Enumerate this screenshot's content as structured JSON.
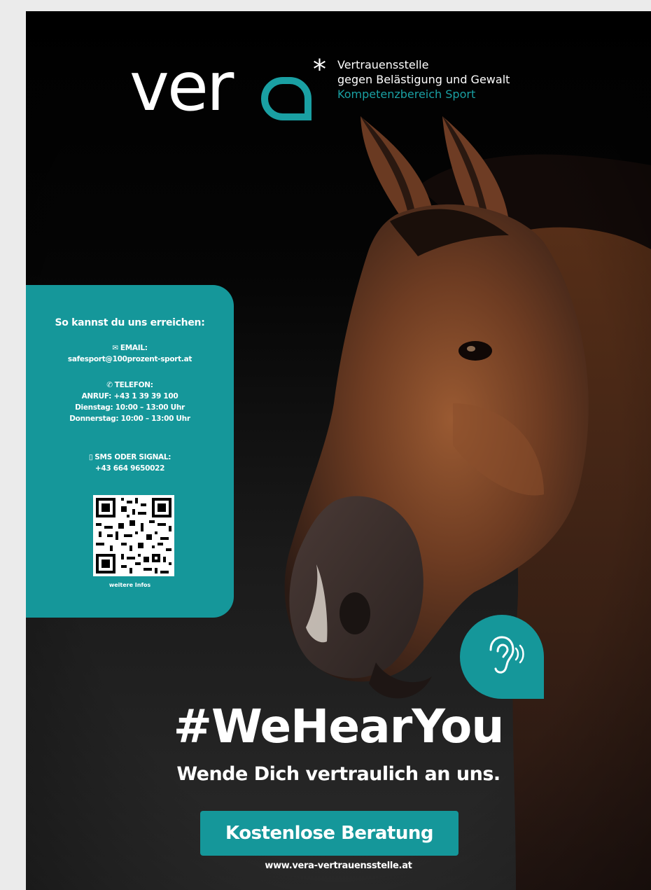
{
  "logo": {
    "word": "ver",
    "star": "*",
    "tagline_line1": "Vertrauensstelle",
    "tagline_line2": "gegen Belästigung und Gewalt",
    "tagline_line3": "Kompetenzbereich Sport",
    "accent_color": "#1aa0a3"
  },
  "contact": {
    "title": "So kannst du uns erreichen:",
    "email_icon": "envelope-icon",
    "email_label": "EMAIL:",
    "email_value": "safesport@100prozent-sport.at",
    "phone_icon": "phone-icon",
    "phone_label": "TELEFON:",
    "phone_call": "ANRUF: +43 1 39 39 100",
    "phone_hours1": "Dienstag: 10:00 – 13:00 Uhr",
    "phone_hours2": "Donnerstag: 10:00 – 13:00 Uhr",
    "sms_icon": "mobile-icon",
    "sms_label": "SMS ODER SIGNAL:",
    "sms_value": "+43 664 9650022",
    "qr_caption": "weitere Infos",
    "panel_color": "#15979a"
  },
  "ear_icon": "ear-listening-icon",
  "hashtag": "#WeHearYou",
  "subline": "Wende Dich vertraulich an uns.",
  "cta_label": "Kostenlose Beratung",
  "url": "www.vera-vertrauensstelle.at"
}
